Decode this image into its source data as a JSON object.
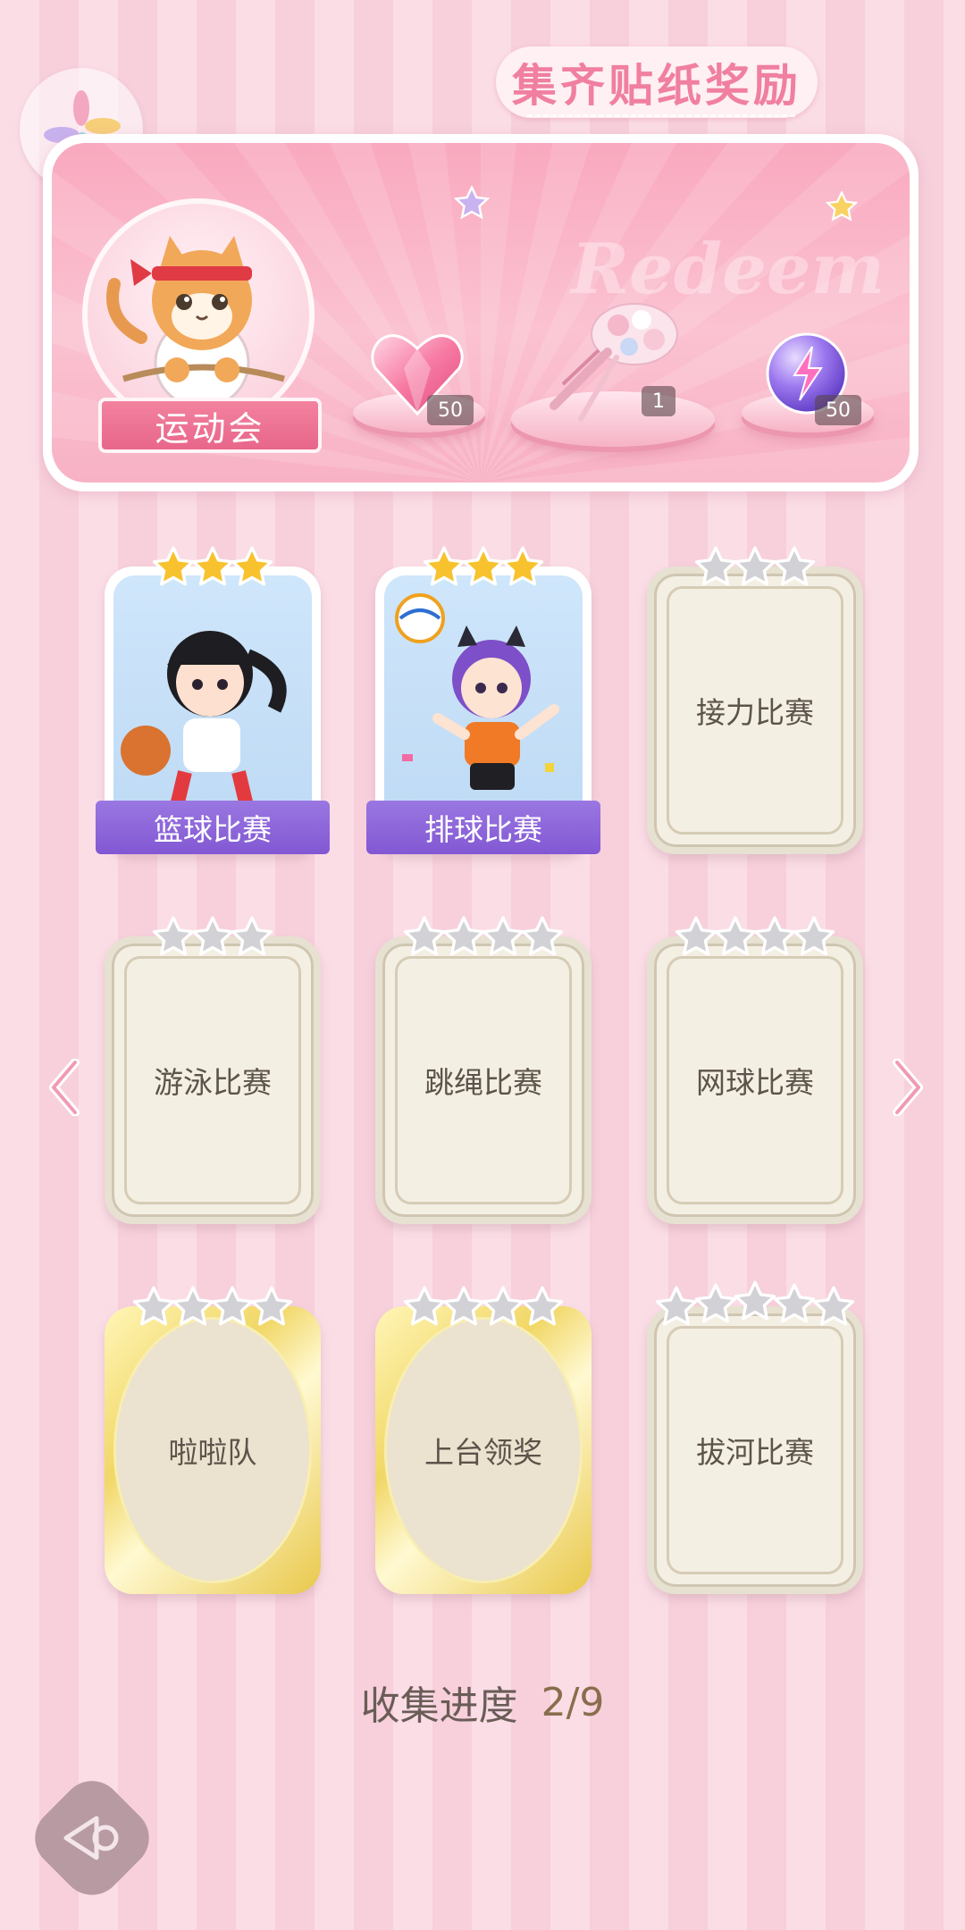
{
  "banner": {
    "title": "集齐贴纸奖励",
    "watermark": "Redeem",
    "event_label": "运动会",
    "rewards": [
      {
        "icon": "pink-heart-gem-icon",
        "count": "50"
      },
      {
        "icon": "flower-bouquet-icon",
        "count": "1"
      },
      {
        "icon": "purple-energy-orb-icon",
        "count": "50"
      }
    ]
  },
  "stickers": [
    {
      "name": "篮球比赛",
      "stars_total": 3,
      "stars_earned": 3,
      "state": "collected"
    },
    {
      "name": "排球比赛",
      "stars_total": 3,
      "stars_earned": 3,
      "state": "collected"
    },
    {
      "name": "接力比赛",
      "stars_total": 3,
      "stars_earned": 0,
      "state": "locked"
    },
    {
      "name": "游泳比赛",
      "stars_total": 3,
      "stars_earned": 0,
      "state": "locked"
    },
    {
      "name": "跳绳比赛",
      "stars_total": 4,
      "stars_earned": 0,
      "state": "locked"
    },
    {
      "name": "网球比赛",
      "stars_total": 4,
      "stars_earned": 0,
      "state": "locked"
    },
    {
      "name": "啦啦队",
      "stars_total": 4,
      "stars_earned": 0,
      "state": "locked-gold"
    },
    {
      "name": "上台领奖",
      "stars_total": 4,
      "stars_earned": 0,
      "state": "locked-gold"
    },
    {
      "name": "拔河比赛",
      "stars_total": 5,
      "stars_earned": 0,
      "state": "locked"
    }
  ],
  "progress": {
    "label": "收集进度",
    "value": "2/9",
    "collected": 2,
    "total": 9
  },
  "colors": {
    "banner_pink": "#f9a9bf",
    "star_gold": "#f7c22e",
    "star_silver": "#d2d2d6",
    "name_strip": "#8a62d8"
  }
}
